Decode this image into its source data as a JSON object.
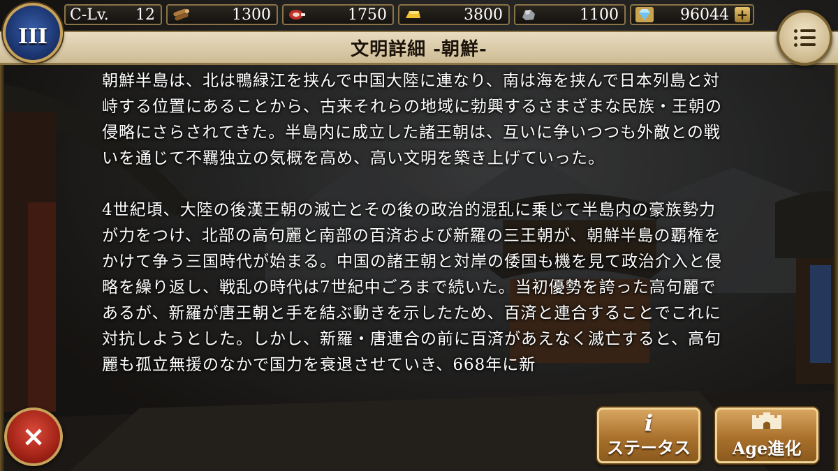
{
  "header": {
    "civ_level": {
      "label": "C-Lv.",
      "value": "12"
    },
    "resources": [
      {
        "name": "wood",
        "icon": "wood-icon",
        "value": "1300"
      },
      {
        "name": "food",
        "icon": "meat-icon",
        "value": "1750"
      },
      {
        "name": "gold",
        "icon": "gold-icon",
        "value": "3800"
      },
      {
        "name": "iron",
        "icon": "iron-ore-icon",
        "value": "1100"
      }
    ],
    "gems": {
      "icon": "diamond-icon",
      "value": "96044",
      "add_label": "+"
    },
    "age_emblem": "III",
    "title": "文明詳細 -朝鮮-"
  },
  "content": {
    "paragraphs": [
      "朝鮮半島は、北は鴨緑江を挟んで中国大陸に連なり、南は海を挟んで日本列島と対峙する位置にあることから、古来それらの地域に勃興するさまざまな民族・王朝の侵略にさらされてきた。半島内に成立した諸王朝は、互いに争いつつも外敵との戦いを通じて不羈独立の気概を高め、高い文明を築き上げていった。",
      "4世紀頃、大陸の後漢王朝の滅亡とその後の政治的混乱に乗じて半島内の豪族勢力が力をつけ、北部の高句麗と南部の百済および新羅の三王朝が、朝鮮半島の覇権をかけて争う三国時代が始まる。中国の諸王朝と対岸の倭国も機を見て政治介入と侵略を繰り返し、戦乱の時代は7世紀中ごろまで続いた。当初優勢を誇った高句麗であるが、新羅が唐王朝と手を結ぶ動きを示したため、百済と連合することでこれに対抗しようとした。しかし、新羅・唐連合の前に百済があえなく滅亡すると、高句麗も孤立無援のなかで国力を衰退させていき、668年に新"
    ]
  },
  "buttons": {
    "close": "×",
    "status_icon": "i",
    "status": "ステータス",
    "age": "Age進化"
  },
  "colors": {
    "frame_gold": "#c7a25a",
    "title_bg": "#e8dcc0",
    "button_orange": "#a9702c",
    "close_red": "#a32317"
  }
}
